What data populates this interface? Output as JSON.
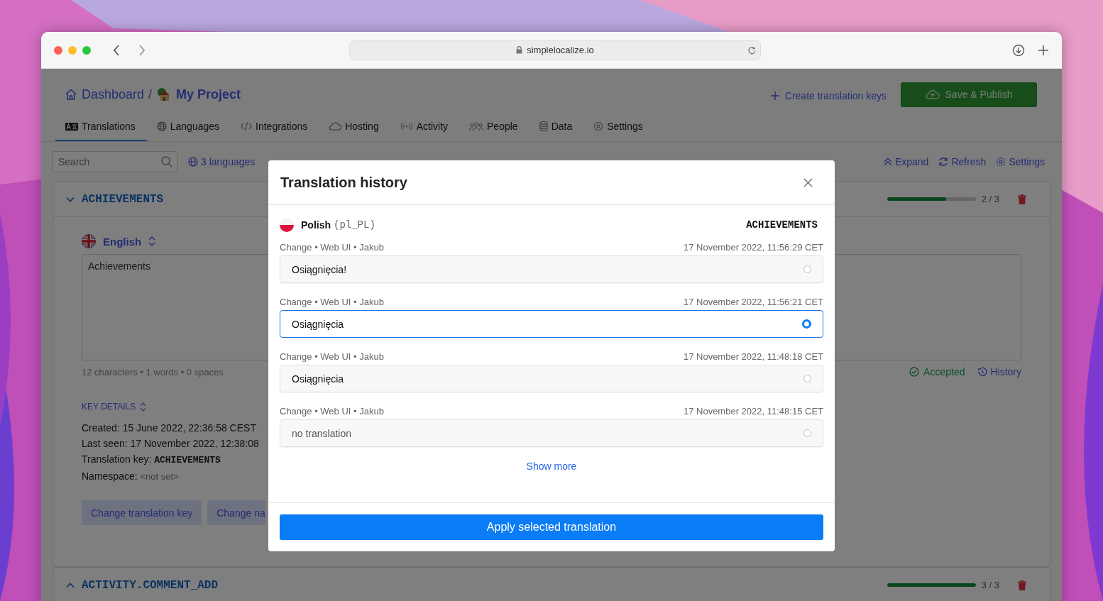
{
  "browser": {
    "url": "simplelocalize.io"
  },
  "breadcrumb": {
    "home": "Dashboard",
    "separator": "/",
    "project": "My Project"
  },
  "header_actions": {
    "create": "Create translation keys",
    "publish": "Save & Publish"
  },
  "tabs": [
    {
      "label": "Translations",
      "selected": true
    },
    {
      "label": "Languages",
      "selected": false
    },
    {
      "label": "Integrations",
      "selected": false
    },
    {
      "label": "Hosting",
      "selected": false
    },
    {
      "label": "Activity",
      "selected": false
    },
    {
      "label": "People",
      "selected": false
    },
    {
      "label": "Data",
      "selected": false
    },
    {
      "label": "Settings",
      "selected": false
    }
  ],
  "toolbar": {
    "search_placeholder": "Search",
    "languages": "3 languages",
    "actions": [
      "Expand",
      "Refresh",
      "Settings"
    ]
  },
  "keys": [
    {
      "key": "ACHIEVEMENTS",
      "expanded": true,
      "level": 0.667,
      "count": "2 / 3"
    },
    {
      "key": "ACTIVITY.COMMENT_ADD",
      "expanded": false,
      "level": 1,
      "count": "3 / 3"
    }
  ],
  "editor": {
    "language": "English",
    "text": "Achievements",
    "stats": "12 characters • 1 words • 0 spaces",
    "status": "Accepted",
    "history": "History"
  },
  "key_details": {
    "heading": "KEY DETAILS",
    "lines": [
      {
        "label": "Created:",
        "value": "15 June 2022, 22:36:58 CEST",
        "kind": "plain"
      },
      {
        "label": "Last seen:",
        "value": "17 November 2022, 12:38:08",
        "kind": "plain"
      },
      {
        "label": "Translation key:",
        "value": "ACHIEVEMENTS",
        "kind": "code"
      },
      {
        "label": "Namespace:",
        "value": "<not set>",
        "kind": "muted"
      }
    ],
    "buttons": [
      "Change translation key",
      "Change na"
    ]
  },
  "modal": {
    "title": "Translation history",
    "language": "Polish",
    "locale": "(pl_PL)",
    "key": "ACHIEVEMENTS",
    "entries": [
      {
        "meta": "Change • Web UI • Jakub",
        "date": "17 November 2022, 11:56:29 CET",
        "text": "Osiągnięcia!",
        "kind": "value",
        "selected": false
      },
      {
        "meta": "Change • Web UI • Jakub",
        "date": "17 November 2022, 11:56:21 CET",
        "text": "Osiągnięcia",
        "kind": "value",
        "selected": true
      },
      {
        "meta": "Change • Web UI • Jakub",
        "date": "17 November 2022, 11:48:18 CET",
        "text": "Osiągnięcia",
        "kind": "value",
        "selected": false
      },
      {
        "meta": "Change • Web UI • Jakub",
        "date": "17 November 2022, 11:48:15 CET",
        "text": "no translation",
        "kind": "empty",
        "selected": false
      }
    ],
    "show_more": "Show more",
    "apply": "Apply selected translation"
  }
}
